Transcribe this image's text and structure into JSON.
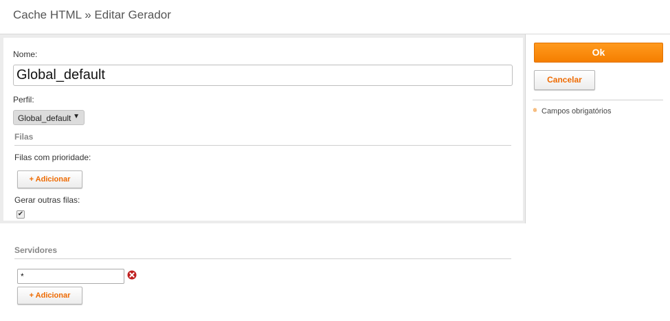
{
  "header": {
    "title": "Cache HTML » Editar Gerador"
  },
  "form": {
    "nome_label": "Nome:",
    "nome_value": "Global_default",
    "perfil_label": "Perfil:",
    "perfil_selected": "Global_default",
    "filas_section": "Filas",
    "filas_prioridade_label": "Filas com prioridade:",
    "add_label": "+ Adicionar",
    "gerar_outras_label": "Gerar outras filas:",
    "gerar_outras_checked": true,
    "checkbox_glyph": "✔",
    "servidores_section": "Servidores",
    "servidor_value": "*",
    "add_servidor_label": "+ Adicionar"
  },
  "sidebar": {
    "ok_label": "Ok",
    "cancel_label": "Cancelar",
    "required_marker": "✲",
    "required_text": "Campos obrigatórios"
  },
  "colors": {
    "accent": "#f57f00",
    "remove_icon": "#c02020"
  }
}
